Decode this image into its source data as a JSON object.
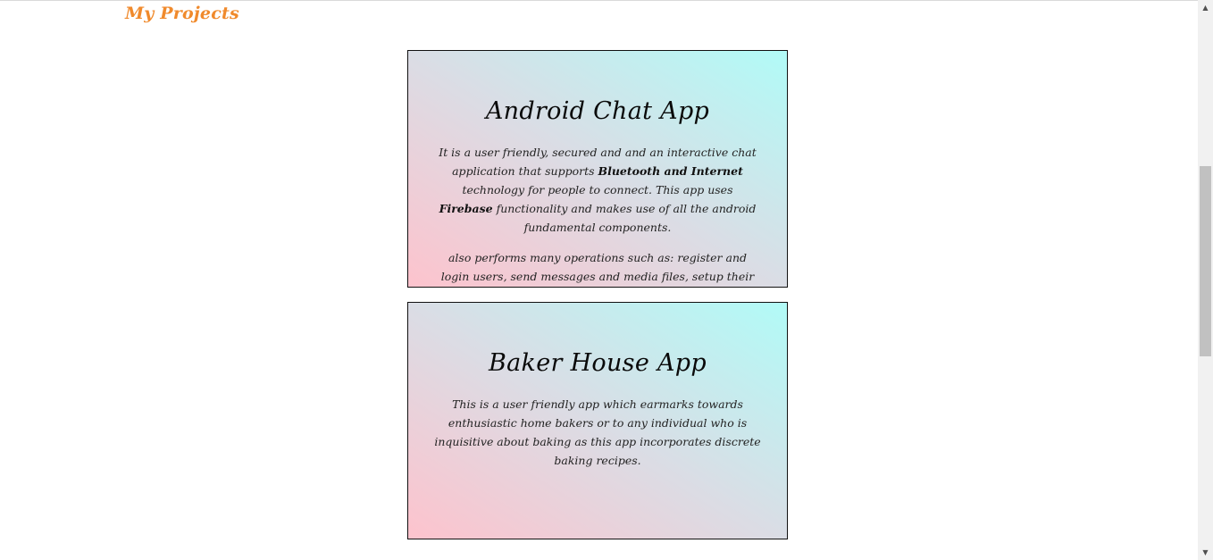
{
  "section": {
    "title": "My Projects"
  },
  "projects": [
    {
      "title": "Android Chat App",
      "description_parts": [
        "It is a user friendly, secured and and an interactive chat application that supports ",
        "Bluetooth and Internet",
        " technology for people to connect. This app uses ",
        "Firebase",
        " functionality and makes use of all the android fundamental components."
      ],
      "extra": "also performs many operations such as: register and login users, send messages and media files, setup their user profile and with a significant feature to delete their sent messages"
    },
    {
      "title": "Baker House App",
      "description": "This is a user friendly app which earmarks towards enthusiastic home bakers or to any individual who is inquisitive about baking as this app incorporates discrete baking recipes."
    }
  ],
  "colors": {
    "title_accent": "#f08a2c",
    "card_gradient_start": "#fdc3cd",
    "card_gradient_mid": "#dadde5",
    "card_gradient_end": "#b1fbf7"
  },
  "icons": {
    "scroll_up": "triangle-up",
    "scroll_down": "triangle-down"
  }
}
